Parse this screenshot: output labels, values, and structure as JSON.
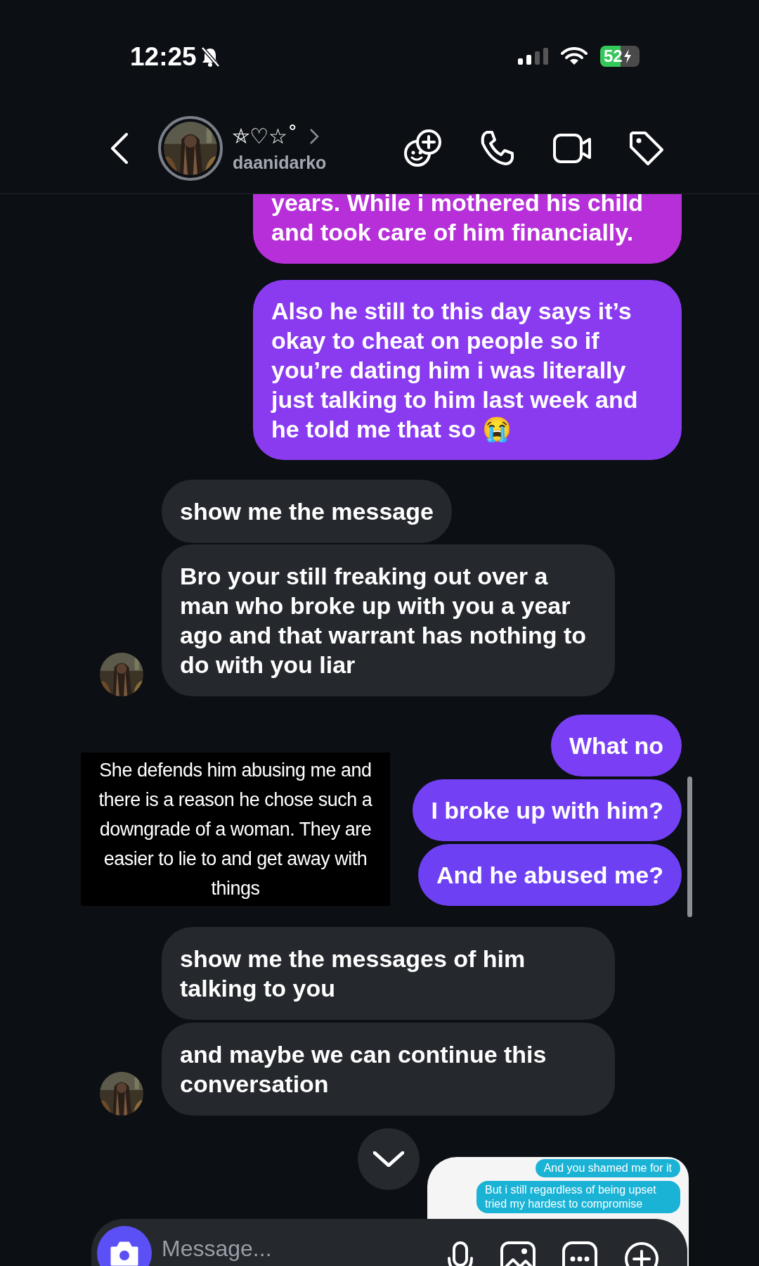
{
  "status_bar": {
    "time": "12:25",
    "silenced": true,
    "battery": "52",
    "charging": true
  },
  "header": {
    "title": "⛤♡☆˚",
    "username": "daanidarko"
  },
  "messages": [
    {
      "kind": "sent",
      "text": "years. While i mothered his child and took care of him financially."
    },
    {
      "kind": "sent",
      "text": "Also he still to this day says it’s okay to cheat on people so if you’re dating him i was literally just talking to him last week and he told me that so 😭"
    },
    {
      "kind": "received",
      "text": "show me the message",
      "avatar": false
    },
    {
      "kind": "received",
      "text": "Bro your still freaking out over a man who broke up with you a year ago and that warrant has nothing to do with you liar",
      "avatar": true
    },
    {
      "kind": "sent",
      "text": "What no"
    },
    {
      "kind": "sent",
      "text": "I broke up with him?"
    },
    {
      "kind": "sent",
      "text": "And he abused me?"
    },
    {
      "kind": "received",
      "text": "show me the messages of him talking to you",
      "avatar": false
    },
    {
      "kind": "received",
      "text": "and maybe we can continue this conversation",
      "avatar": true
    }
  ],
  "caption": "She defends him abusing me and there is a reason he chose such a downgrade of a woman. They are easier to lie to and get away with things",
  "shared_screenshot": {
    "messages": [
      "And you shamed me for it",
      "But i still regardless of being upset tried my hardest to compromise"
    ]
  },
  "composer": {
    "placeholder": "Message..."
  }
}
